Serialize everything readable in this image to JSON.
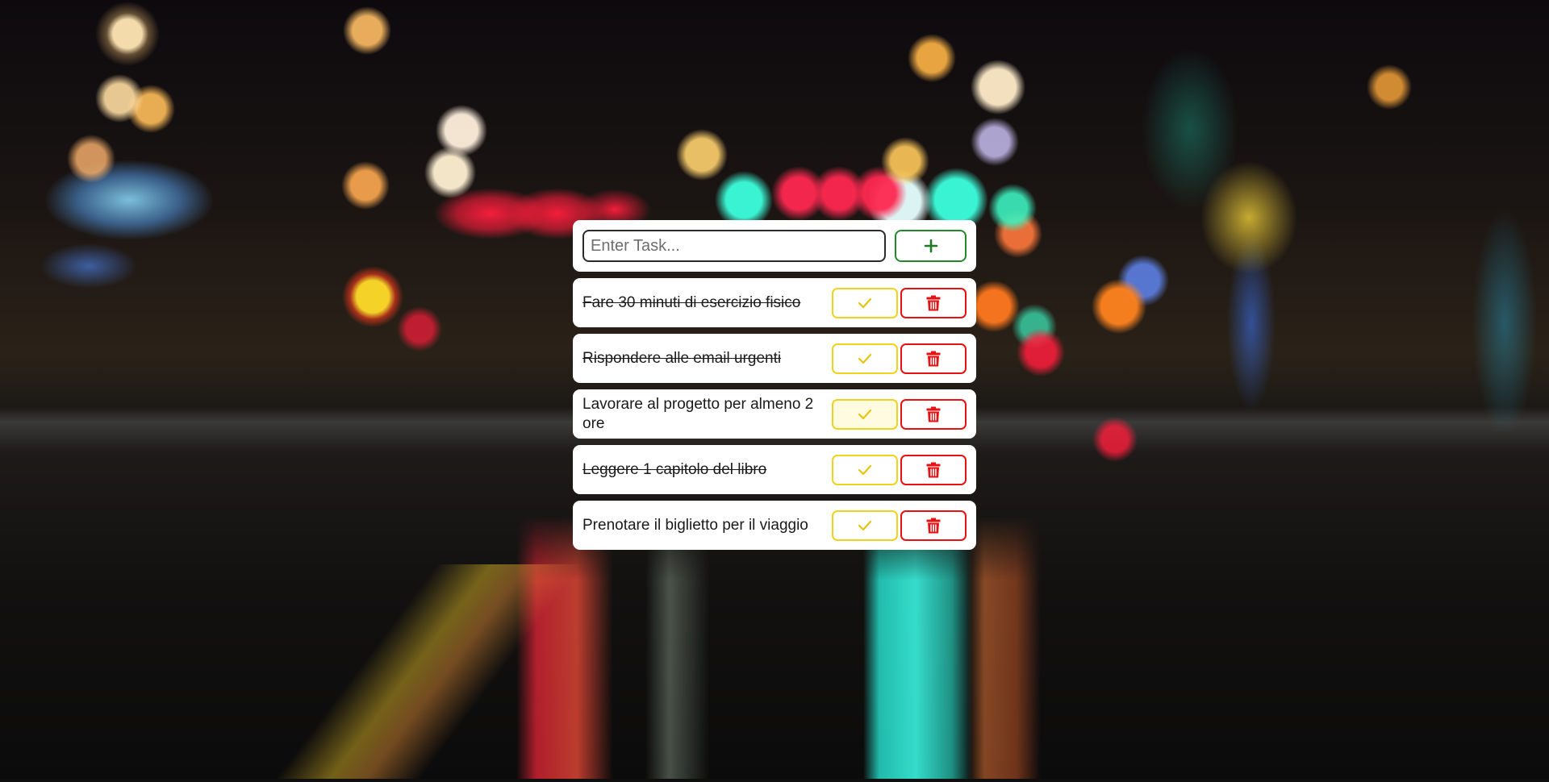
{
  "theme": {
    "add_color": "#1f8a2a",
    "check_color": "#f2d21c",
    "delete_color": "#e81010"
  },
  "input_bar": {
    "placeholder": "Enter Task...",
    "value": "",
    "add_icon": "plus-icon"
  },
  "tasks": [
    {
      "text": "Fare 30 minuti di esercizio fisico",
      "completed": true
    },
    {
      "text": "Rispondere alle email urgenti",
      "completed": true
    },
    {
      "text": "Lavorare al progetto per almeno 2 ore",
      "completed": false
    },
    {
      "text": "Leggere 1 capitolo del libro",
      "completed": true
    },
    {
      "text": "Prenotare il biglietto per il viaggio",
      "completed": false
    }
  ],
  "task_icons": {
    "complete": "check-icon",
    "delete": "trash-icon"
  }
}
